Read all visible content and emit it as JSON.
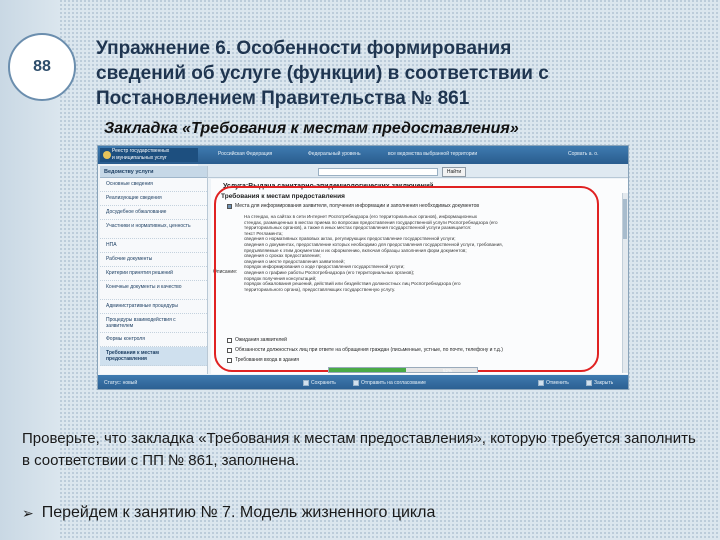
{
  "slide": {
    "page_number": "88",
    "title_lines": [
      "Упражнение 6. Особенности формирования",
      "сведений об услуге (функции) в соответствии с",
      "Постановлением Правительства № 861"
    ],
    "subtitle": "Закладка «Требования к местам предоставления»",
    "body_text": "Проверьте, что закладка «Требования к местам предоставления», которую требуется заполнить в соответствии с ПП № 861, заполнена.",
    "bullet_text": "Перейдем к занятию № 7. Модель жизненного цикла"
  },
  "screen": {
    "logo_lines": [
      "Реестр государственных",
      "и муниципальных услуг"
    ],
    "topnav": [
      "Российская Федерация",
      "Федеральный уровень",
      "все ведомства выбранной территории",
      "Сорвать а. о."
    ],
    "search_button": "Найти",
    "sidebar_head": "Ведомству услуги",
    "sidebar_items": [
      "Основные сведения",
      "Реализующие сведения",
      "Досудебное обжалование",
      "Участники и нормативных, ценность",
      "НПА",
      "Рабочие документы",
      "Критерии принятия решений",
      "Конечные документы и качество",
      "Административные процедуры",
      "Процедуры взаимодействия с заявителем",
      "Формы контроля",
      "Требования к местам предоставления"
    ],
    "form_caption": "Услуга:Выдача санитарно-эпидемиологических заключений",
    "section_caption": "Требования к местам предоставления",
    "checkbox_top": "Места для информирования заявителя, получения информации и заполнения необходимых документов",
    "purpose_label": "Описание:",
    "description_lines": [
      "На стендах, на сайтах в сети Интернет Роспотребнадзора (его территориальных органов), информационных",
      "стендах, размещенных в местах приема по вопросам предоставления государственной услуги Роспотребнадзора (его",
      "территориальных органов), а также в иных местах предоставления государственной услуги размещается:",
      "текст Регламента;",
      "сведения о нормативных правовых актах, регулирующих предоставление государственной услуги;",
      "сведения о документах, предоставление которых необходимо для предоставления государственной услуги, требования,",
      "предъявляемые к этим документам и их оформлению, включая образцы заполнения форм документов;",
      "сведения о сроках предоставления;",
      "сведения о месте предоставления заявителей;",
      "порядок информирования о ходе предоставления государственной услуги;",
      "сведения о графике работы Роспотребнадзора (его территориальных органов);",
      "порядок получения консультаций;",
      "порядок обжалования решений, действий или бездействия должностных лиц Роспотребнадзора (его",
      "территориального органа), предоставляющих государственную услугу."
    ],
    "checkbox_bottom_1": "Ожидания заявителей",
    "checkbox_bottom_2": "Обязанности должностных лиц при ответе на обращения граждан (письменные, устные, по почте, телефону и т.д.)",
    "checkbox_bottom_3": "Требования входа в здания",
    "progress_percent": 52,
    "progress_label": "52%",
    "status_label": "Статус: новый",
    "status_actions": [
      "Сохранить",
      "Отправить на согласование",
      "Отменить",
      "Закрыть"
    ]
  }
}
